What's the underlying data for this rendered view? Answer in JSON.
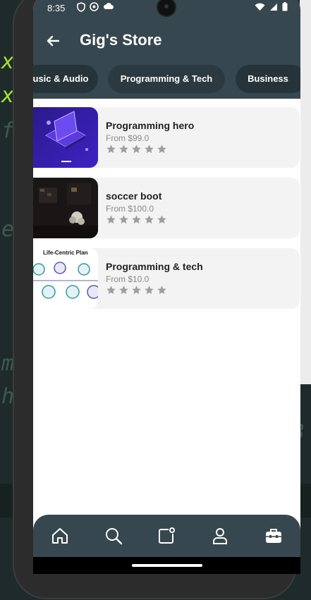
{
  "status_bar": {
    "time": "8:35"
  },
  "app_bar": {
    "title": "Gig's Store"
  },
  "tabs": [
    {
      "label": "usic & Audio"
    },
    {
      "label": "Programming & Tech"
    },
    {
      "label": "Business"
    }
  ],
  "items": [
    {
      "title": "Programming hero",
      "price": "From $99.0",
      "rating": 0,
      "max_rating": 5
    },
    {
      "title": "soccer boot",
      "price": "From $100.0",
      "rating": 0,
      "max_rating": 5
    },
    {
      "title": "Programming & tech",
      "price": "From $10.0",
      "rating": 0,
      "max_rating": 5,
      "thumb_caption": "Life-Centric Plan"
    }
  ],
  "bottom_nav": {
    "items": [
      {
        "icon": "home-icon"
      },
      {
        "icon": "search-icon"
      },
      {
        "icon": "add-post-icon"
      },
      {
        "icon": "profile-icon"
      },
      {
        "icon": "briefcase-icon"
      }
    ]
  },
  "colors": {
    "app_bar": "#37474f",
    "card_bg": "#f3f3f3",
    "star": "#9e9e9e",
    "accent_green": "#a6e22e"
  }
}
